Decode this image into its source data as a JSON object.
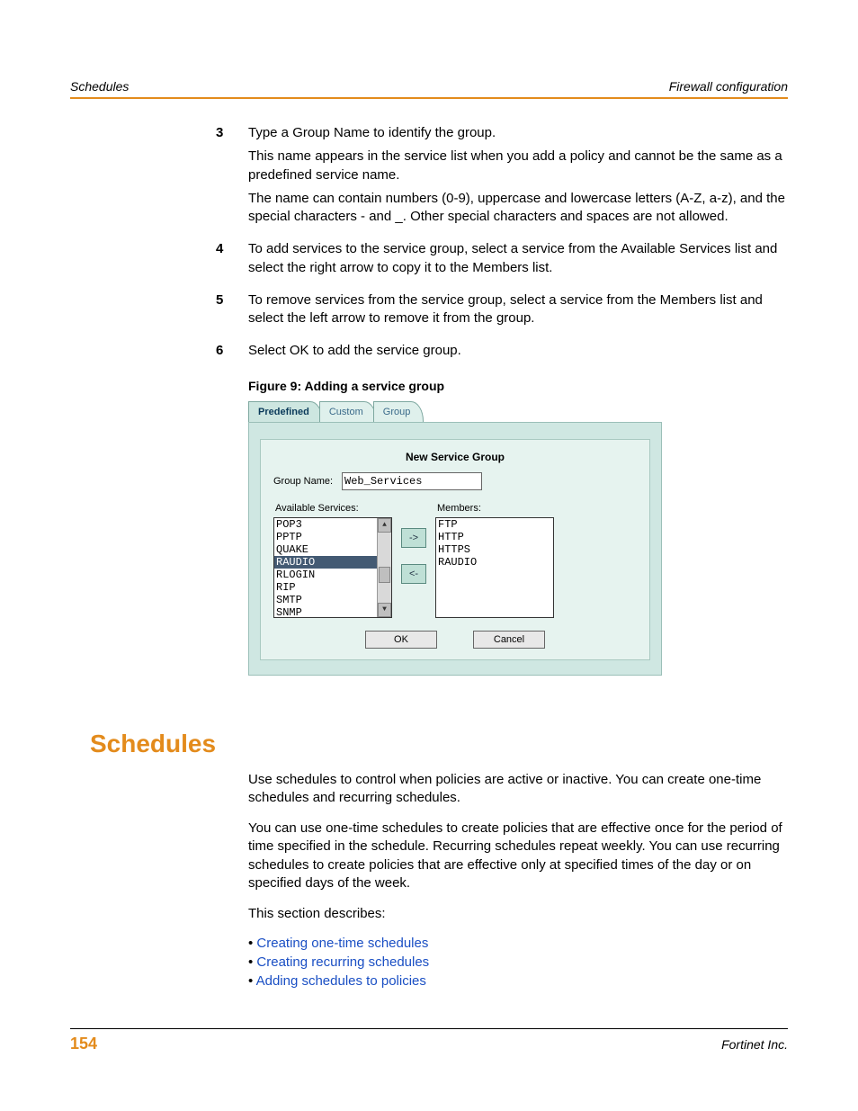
{
  "header": {
    "left": "Schedules",
    "right": "Firewall configuration"
  },
  "steps": [
    {
      "num": "3",
      "paras": [
        "Type a Group Name to identify the group.",
        "This name appears in the service list when you add a policy and cannot be the same as a predefined service name.",
        "The name can contain numbers (0-9), uppercase and lowercase letters (A-Z, a-z), and the special characters - and _. Other special characters and spaces are not allowed."
      ]
    },
    {
      "num": "4",
      "paras": [
        "To add services to the service group, select a service from the Available Services list and select the right arrow to copy it to the Members list."
      ]
    },
    {
      "num": "5",
      "paras": [
        "To remove services from the service group, select a service from the Members list and select the left arrow to remove it from the group."
      ]
    },
    {
      "num": "6",
      "paras": [
        "Select OK to add the service group."
      ]
    }
  ],
  "figure": {
    "caption": "Figure 9:   Adding a service group",
    "tabs": {
      "predefined": "Predefined",
      "custom": "Custom",
      "group": "Group"
    },
    "panel_title": "New Service Group",
    "group_name_label": "Group Name:",
    "group_name_value": "Web_Services",
    "available_label": "Available Services:",
    "members_label": "Members:",
    "available": [
      "POP3",
      "PPTP",
      "QUAKE",
      "RAUDIO",
      "RLOGIN",
      "RIP",
      "SMTP",
      "SNMP"
    ],
    "available_selected_index": 3,
    "members": [
      "FTP",
      "HTTP",
      "HTTPS",
      "RAUDIO"
    ],
    "arrow_right": "->",
    "arrow_left": "<-",
    "ok": "OK",
    "cancel": "Cancel"
  },
  "section": {
    "title": "Schedules",
    "p1": "Use schedules to control when policies are active or inactive. You can create one-time schedules and recurring schedules.",
    "p2": "You can use one-time schedules to create policies that are effective once for the period of time specified in the schedule. Recurring schedules repeat weekly. You can use recurring schedules to create policies that are effective only at specified times of the day or on specified days of the week.",
    "p3": "This section describes:",
    "links": [
      "Creating one-time schedules",
      "Creating recurring schedules",
      "Adding schedules to policies"
    ]
  },
  "footer": {
    "page": "154",
    "company": "Fortinet Inc."
  }
}
